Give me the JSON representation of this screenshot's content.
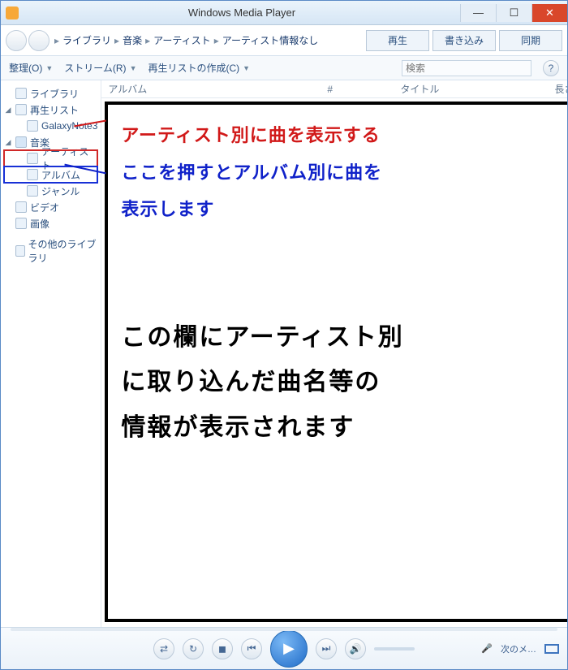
{
  "title": "Windows Media Player",
  "breadcrumbs": [
    "ライブラリ",
    "音楽",
    "アーティスト",
    "アーティスト情報なし"
  ],
  "tabs": {
    "play": "再生",
    "burn": "書き込み",
    "sync": "同期"
  },
  "toolbar": {
    "organize": "整理(O)",
    "stream": "ストリーム(R)",
    "create": "再生リストの作成(C)"
  },
  "search_placeholder": "検索",
  "columns": {
    "album": "アルバム",
    "num": "#",
    "title": "タイトル",
    "length": "長さ"
  },
  "sidebar": {
    "library": "ライブラリ",
    "playlists": "再生リスト",
    "playlist_item": "GalaxyNote3",
    "music": "音楽",
    "artist": "アーティスト",
    "album": "アルバム",
    "genre": "ジャンル",
    "video": "ビデオ",
    "image": "画像",
    "other": "その他のライブラリ"
  },
  "annotations": {
    "red": "アーティスト別に曲を表示する",
    "blue1": "ここを押すとアルバム別に曲を",
    "blue2": "表示します",
    "big1": "この欄にアーティスト別",
    "big2": "に取り込んだ曲名等の",
    "big3": "情報が表示されます"
  },
  "player_status": "次のメ…"
}
